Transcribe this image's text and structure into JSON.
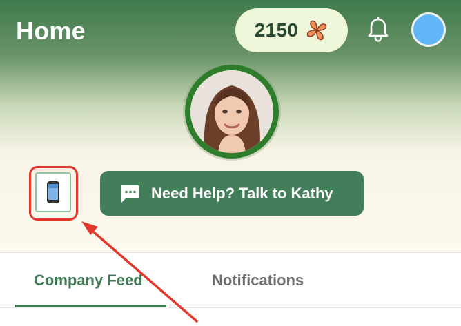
{
  "header": {
    "title": "Home",
    "points": "2150",
    "icons": {
      "points": "pinwheel-icon",
      "notifications": "bell-icon",
      "avatar": "user-avatar"
    },
    "colors": {
      "gradient_top": "#3f7a4c",
      "gradient_bottom": "#fdf9ef",
      "pill_bg": "#eef7d9",
      "avatar_bg": "#61b6f7"
    }
  },
  "profile": {
    "ring_color": "#2e7d2a"
  },
  "actions": {
    "device_icon": "mobile-phone-icon",
    "help_button_label": "Need Help? Talk to Kathy",
    "help_button_icon": "chat-bubble-icon",
    "help_button_color": "#427e59"
  },
  "annotation": {
    "highlight_color": "#e2382b"
  },
  "tabs": [
    {
      "label": "Company Feed",
      "active": true
    },
    {
      "label": "Notifications",
      "active": false
    }
  ],
  "tab_accent": "#3f7a55"
}
